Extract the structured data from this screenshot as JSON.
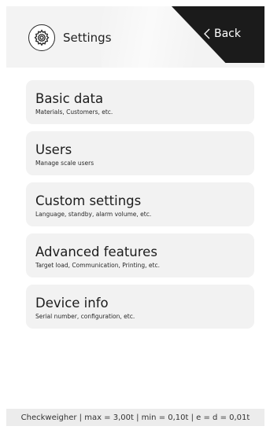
{
  "header": {
    "title": "Settings",
    "icon": "gear-icon",
    "back_label": "Back",
    "back_icon": "chevron-left-icon"
  },
  "menu": {
    "items": [
      {
        "title": "Basic data",
        "subtitle": "Materials, Customers, etc."
      },
      {
        "title": "Users",
        "subtitle": "Manage scale users"
      },
      {
        "title": "Custom settings",
        "subtitle": "Language, standby, alarm volume, etc."
      },
      {
        "title": "Advanced features",
        "subtitle": "Target load, Communication, Printing, etc."
      },
      {
        "title": "Device info",
        "subtitle": "Serial number, configuration, etc."
      }
    ]
  },
  "footer": {
    "status": "Checkweigher | max = 3,00t | min = 0,10t | e = d = 0,01t"
  },
  "colors": {
    "background": "#ffffff",
    "panel": "#f2f2f2",
    "back_tab": "#1b1b1b",
    "text": "#1c1c1c"
  }
}
